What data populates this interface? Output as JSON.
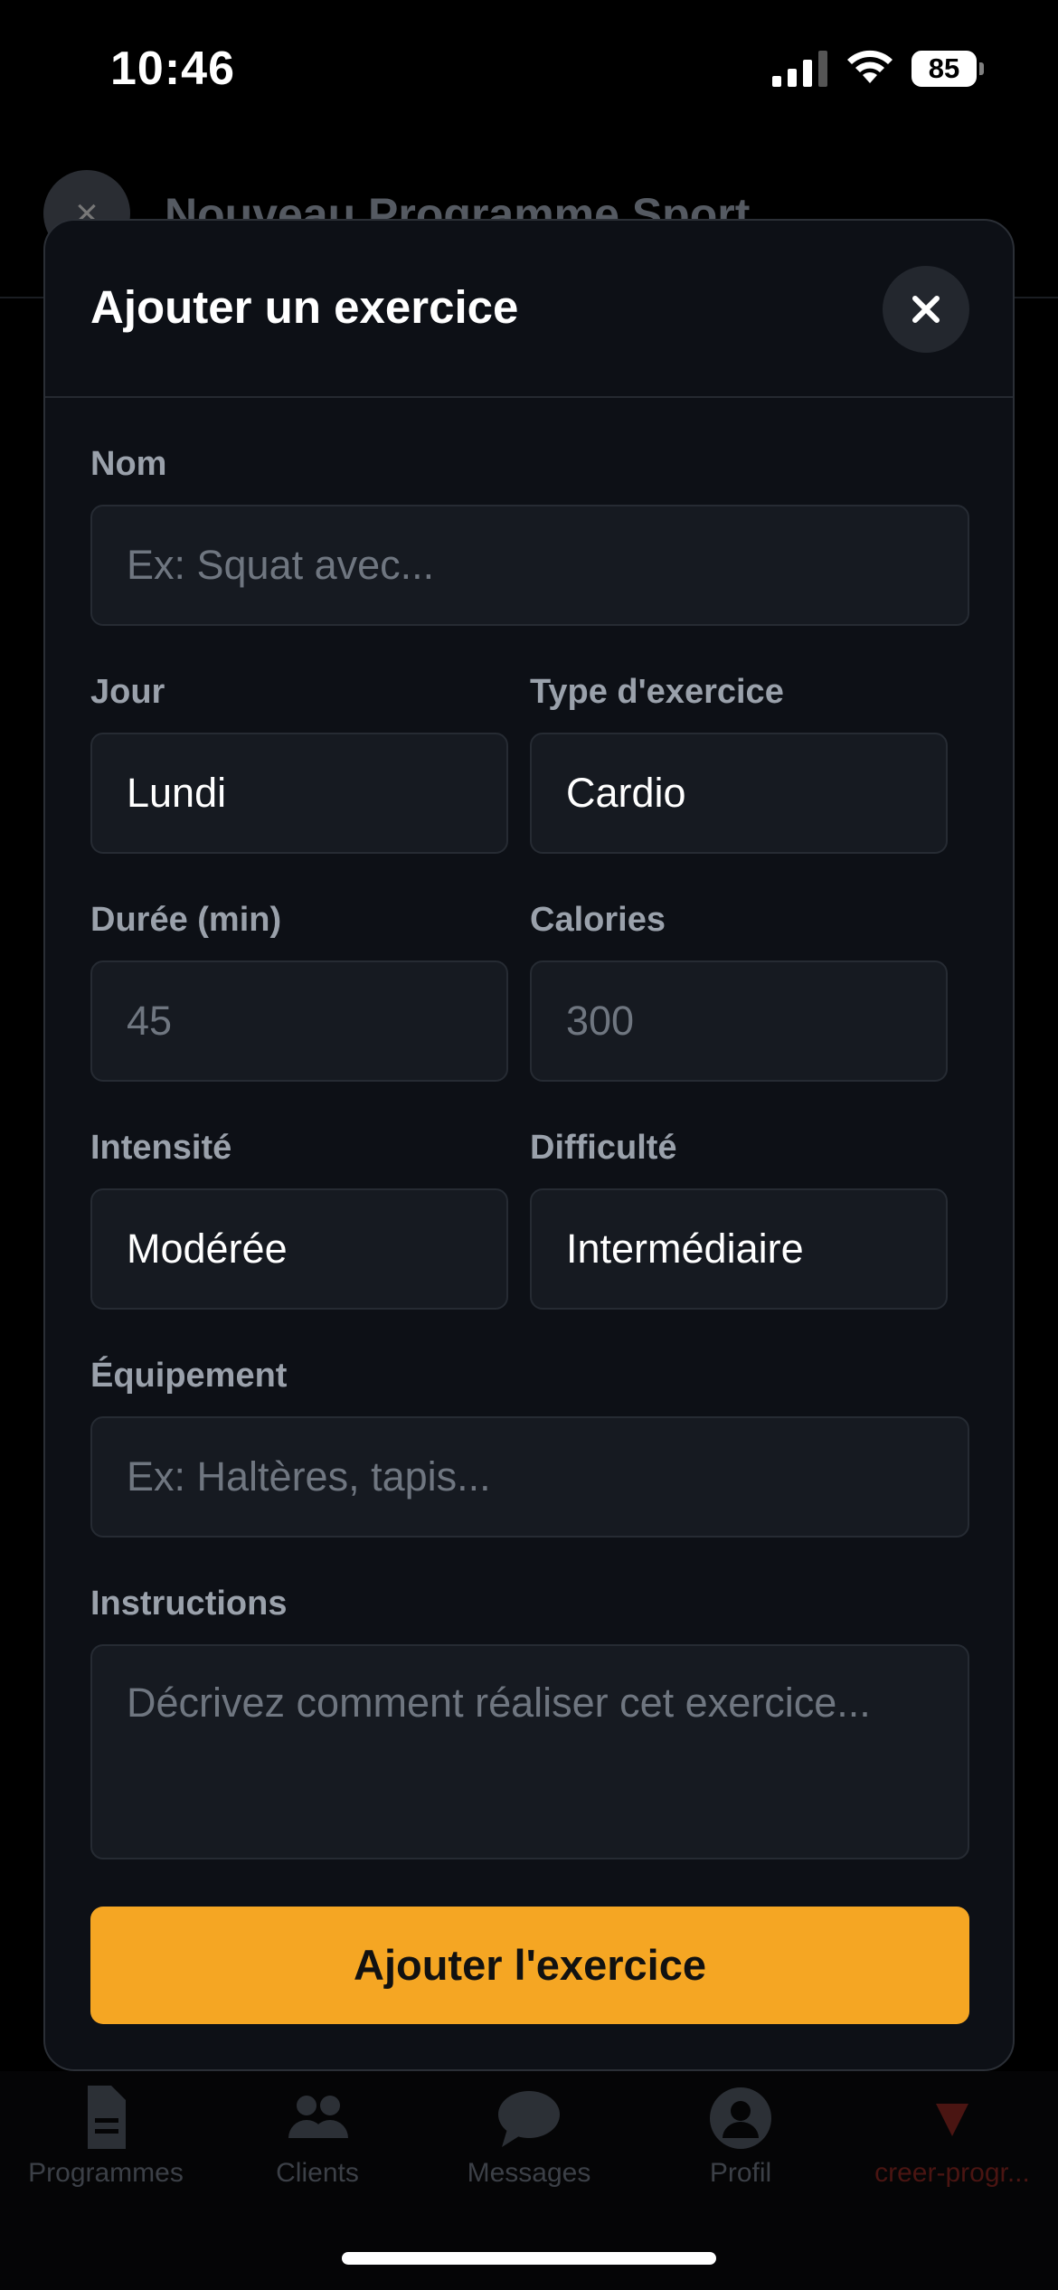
{
  "status_bar": {
    "time": "10:46",
    "battery": "85",
    "signal_icon": "cellular-signal-icon",
    "wifi_icon": "wifi-icon"
  },
  "background": {
    "title": "Nouveau Programme Sport",
    "close_glyph": "×"
  },
  "modal": {
    "title": "Ajouter un exercice",
    "close_icon": "close-icon",
    "fields": {
      "nom": {
        "label": "Nom",
        "placeholder": "Ex: Squat avec..."
      },
      "jour": {
        "label": "Jour",
        "value": "Lundi"
      },
      "type": {
        "label": "Type d'exercice",
        "value": "Cardio"
      },
      "duree": {
        "label": "Durée (min)",
        "placeholder": "45"
      },
      "calories": {
        "label": "Calories",
        "placeholder": "300"
      },
      "intensite": {
        "label": "Intensité",
        "value": "Modérée"
      },
      "difficulte": {
        "label": "Difficulté",
        "value": "Intermédiaire"
      },
      "equipement": {
        "label": "Équipement",
        "placeholder": "Ex: Haltères, tapis..."
      },
      "instructions": {
        "label": "Instructions",
        "placeholder": "Décrivez comment réaliser cet exercice..."
      }
    },
    "submit_label": "Ajouter l'exercice"
  },
  "tabbar": {
    "items": [
      {
        "label": "Programmes",
        "icon": "document-icon"
      },
      {
        "label": "Clients",
        "icon": "users-icon"
      },
      {
        "label": "Messages",
        "icon": "chat-bubble-icon"
      },
      {
        "label": "Profil",
        "icon": "user-circle-icon"
      },
      {
        "label": "creer-progr...",
        "icon": "triangle-down-icon"
      }
    ]
  },
  "colors": {
    "accent": "#f5a623",
    "modal_bg": "#0d1016",
    "field_bg": "#161a21",
    "label": "#9aa1ab"
  }
}
